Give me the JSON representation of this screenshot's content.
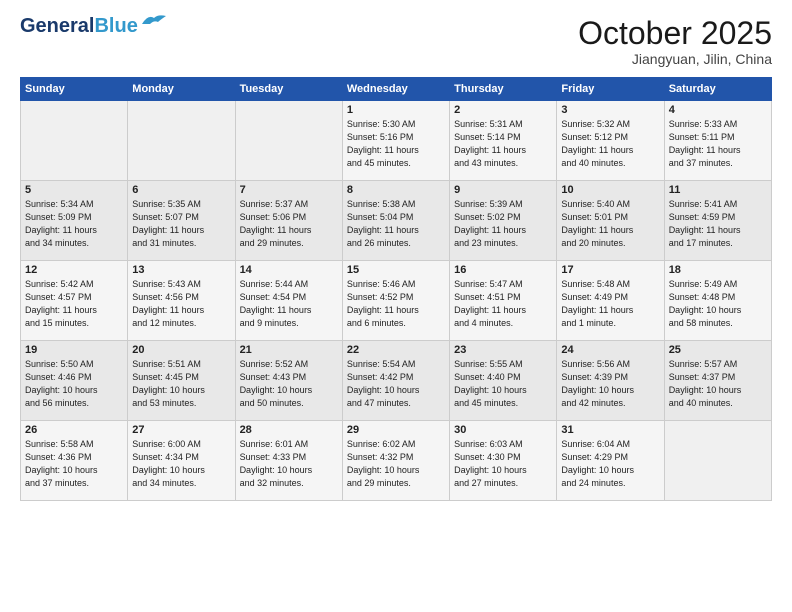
{
  "header": {
    "logo_line1": "General",
    "logo_line2": "Blue",
    "month_year": "October 2025",
    "location": "Jiangyuan, Jilin, China"
  },
  "days_of_week": [
    "Sunday",
    "Monday",
    "Tuesday",
    "Wednesday",
    "Thursday",
    "Friday",
    "Saturday"
  ],
  "weeks": [
    [
      {
        "num": "",
        "info": ""
      },
      {
        "num": "",
        "info": ""
      },
      {
        "num": "",
        "info": ""
      },
      {
        "num": "1",
        "info": "Sunrise: 5:30 AM\nSunset: 5:16 PM\nDaylight: 11 hours\nand 45 minutes."
      },
      {
        "num": "2",
        "info": "Sunrise: 5:31 AM\nSunset: 5:14 PM\nDaylight: 11 hours\nand 43 minutes."
      },
      {
        "num": "3",
        "info": "Sunrise: 5:32 AM\nSunset: 5:12 PM\nDaylight: 11 hours\nand 40 minutes."
      },
      {
        "num": "4",
        "info": "Sunrise: 5:33 AM\nSunset: 5:11 PM\nDaylight: 11 hours\nand 37 minutes."
      }
    ],
    [
      {
        "num": "5",
        "info": "Sunrise: 5:34 AM\nSunset: 5:09 PM\nDaylight: 11 hours\nand 34 minutes."
      },
      {
        "num": "6",
        "info": "Sunrise: 5:35 AM\nSunset: 5:07 PM\nDaylight: 11 hours\nand 31 minutes."
      },
      {
        "num": "7",
        "info": "Sunrise: 5:37 AM\nSunset: 5:06 PM\nDaylight: 11 hours\nand 29 minutes."
      },
      {
        "num": "8",
        "info": "Sunrise: 5:38 AM\nSunset: 5:04 PM\nDaylight: 11 hours\nand 26 minutes."
      },
      {
        "num": "9",
        "info": "Sunrise: 5:39 AM\nSunset: 5:02 PM\nDaylight: 11 hours\nand 23 minutes."
      },
      {
        "num": "10",
        "info": "Sunrise: 5:40 AM\nSunset: 5:01 PM\nDaylight: 11 hours\nand 20 minutes."
      },
      {
        "num": "11",
        "info": "Sunrise: 5:41 AM\nSunset: 4:59 PM\nDaylight: 11 hours\nand 17 minutes."
      }
    ],
    [
      {
        "num": "12",
        "info": "Sunrise: 5:42 AM\nSunset: 4:57 PM\nDaylight: 11 hours\nand 15 minutes."
      },
      {
        "num": "13",
        "info": "Sunrise: 5:43 AM\nSunset: 4:56 PM\nDaylight: 11 hours\nand 12 minutes."
      },
      {
        "num": "14",
        "info": "Sunrise: 5:44 AM\nSunset: 4:54 PM\nDaylight: 11 hours\nand 9 minutes."
      },
      {
        "num": "15",
        "info": "Sunrise: 5:46 AM\nSunset: 4:52 PM\nDaylight: 11 hours\nand 6 minutes."
      },
      {
        "num": "16",
        "info": "Sunrise: 5:47 AM\nSunset: 4:51 PM\nDaylight: 11 hours\nand 4 minutes."
      },
      {
        "num": "17",
        "info": "Sunrise: 5:48 AM\nSunset: 4:49 PM\nDaylight: 11 hours\nand 1 minute."
      },
      {
        "num": "18",
        "info": "Sunrise: 5:49 AM\nSunset: 4:48 PM\nDaylight: 10 hours\nand 58 minutes."
      }
    ],
    [
      {
        "num": "19",
        "info": "Sunrise: 5:50 AM\nSunset: 4:46 PM\nDaylight: 10 hours\nand 56 minutes."
      },
      {
        "num": "20",
        "info": "Sunrise: 5:51 AM\nSunset: 4:45 PM\nDaylight: 10 hours\nand 53 minutes."
      },
      {
        "num": "21",
        "info": "Sunrise: 5:52 AM\nSunset: 4:43 PM\nDaylight: 10 hours\nand 50 minutes."
      },
      {
        "num": "22",
        "info": "Sunrise: 5:54 AM\nSunset: 4:42 PM\nDaylight: 10 hours\nand 47 minutes."
      },
      {
        "num": "23",
        "info": "Sunrise: 5:55 AM\nSunset: 4:40 PM\nDaylight: 10 hours\nand 45 minutes."
      },
      {
        "num": "24",
        "info": "Sunrise: 5:56 AM\nSunset: 4:39 PM\nDaylight: 10 hours\nand 42 minutes."
      },
      {
        "num": "25",
        "info": "Sunrise: 5:57 AM\nSunset: 4:37 PM\nDaylight: 10 hours\nand 40 minutes."
      }
    ],
    [
      {
        "num": "26",
        "info": "Sunrise: 5:58 AM\nSunset: 4:36 PM\nDaylight: 10 hours\nand 37 minutes."
      },
      {
        "num": "27",
        "info": "Sunrise: 6:00 AM\nSunset: 4:34 PM\nDaylight: 10 hours\nand 34 minutes."
      },
      {
        "num": "28",
        "info": "Sunrise: 6:01 AM\nSunset: 4:33 PM\nDaylight: 10 hours\nand 32 minutes."
      },
      {
        "num": "29",
        "info": "Sunrise: 6:02 AM\nSunset: 4:32 PM\nDaylight: 10 hours\nand 29 minutes."
      },
      {
        "num": "30",
        "info": "Sunrise: 6:03 AM\nSunset: 4:30 PM\nDaylight: 10 hours\nand 27 minutes."
      },
      {
        "num": "31",
        "info": "Sunrise: 6:04 AM\nSunset: 4:29 PM\nDaylight: 10 hours\nand 24 minutes."
      },
      {
        "num": "",
        "info": ""
      }
    ]
  ]
}
